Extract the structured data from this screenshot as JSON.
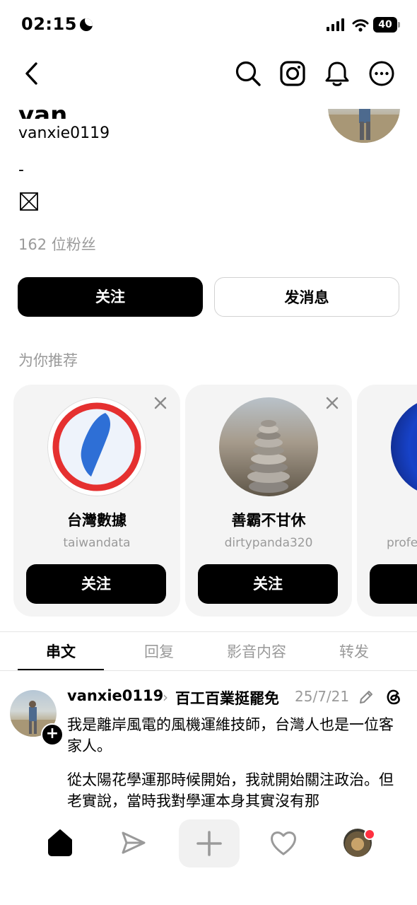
{
  "status_bar": {
    "time": "02:15",
    "battery": "40"
  },
  "profile": {
    "display_name": "van",
    "handle": "vanxie0119",
    "bio_line": "-",
    "followers": "162 位粉丝",
    "follow_label": "关注",
    "message_label": "发消息"
  },
  "recommendations": {
    "title": "为你推荐",
    "items": [
      {
        "name": "台灣數據",
        "handle": "taiwandata",
        "follow_label": "关注"
      },
      {
        "name": "善霸不甘休",
        "handle": "dirtypanda320",
        "follow_label": "关注"
      },
      {
        "name": "",
        "handle": "profe",
        "follow_label": ""
      }
    ]
  },
  "tabs": [
    {
      "label": "串文"
    },
    {
      "label": "回复"
    },
    {
      "label": "影音内容"
    },
    {
      "label": "转发"
    }
  ],
  "post": {
    "username": "vanxie0119",
    "topic": "百工百業挺罷免",
    "date": "25/7/21",
    "paragraph1": "我是離岸風電的風機運維技師，台灣人也是一位客家人。",
    "paragraph2": "從太陽花學運那時候開始，我就開始關注政治。但老實說，當時我對學運本身其實沒有那"
  },
  "colors": {
    "primary": "#000000",
    "muted": "#9a9a9a",
    "card_bg": "#f4f4f4",
    "notification": "#ff3040"
  }
}
